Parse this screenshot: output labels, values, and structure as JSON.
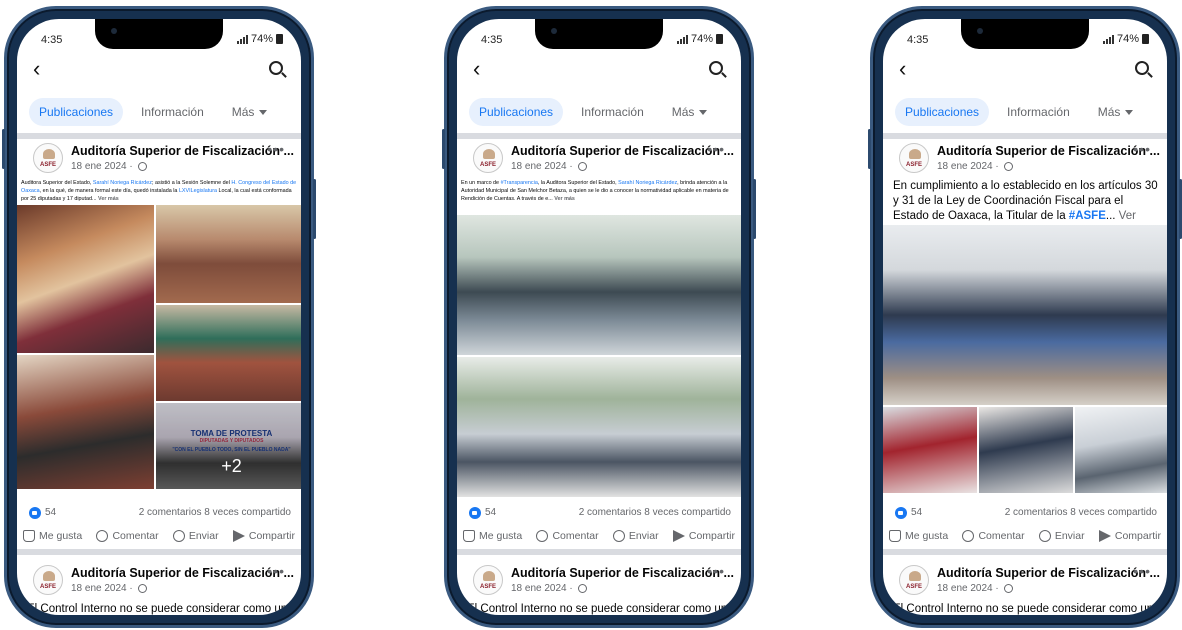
{
  "phones": [
    {
      "status": {
        "time": "4:35",
        "battery": "74%"
      },
      "tabs": {
        "posts": "Publicaciones",
        "info": "Información",
        "more": "Más"
      },
      "post": {
        "page_name": "Auditoría Superior de Fiscalización ...",
        "date": "18 ene 2024 ·",
        "avatar_text": "ASFE",
        "caption_parts": [
          {
            "t": "Auditora Superior del Estado, ",
            "k": "text"
          },
          {
            "t": "Sarahí Noriega Ricárdez",
            "k": "link"
          },
          {
            "t": "; asistió a la Sesión Solemne del ",
            "k": "text"
          },
          {
            "t": "H. Congreso del Estado de Oaxaca",
            "k": "link"
          },
          {
            "t": ", en la qué, de manera formal este día, quedó instalada la ",
            "k": "text"
          },
          {
            "t": "LXVILegislatura",
            "k": "link"
          },
          {
            "t": " Local, la cual está conformada por 25 diputadas y 17 diputad... ",
            "k": "text"
          },
          {
            "t": "Ver más",
            "k": "more"
          }
        ],
        "image_banner": {
          "title": "TOMA DE PROTESTA",
          "subtitle": "DIPUTADAS Y DIPUTADOS",
          "motto": "\"CON EL PUEBLO TODO, SIN EL PUEBLO NADA\""
        },
        "more_photos": "+2",
        "likes": "54",
        "comments_shares": "2 comentarios  8 veces compartido",
        "actions": {
          "like": "Me gusta",
          "comment": "Comentar",
          "send": "Enviar",
          "share": "Compartir"
        }
      },
      "next_post": {
        "page_name": "Auditoría Superior de Fiscalización ...",
        "date": "18 ene 2024 ·",
        "teaser": "El Control Interno no se puede considerar como un"
      }
    },
    {
      "status": {
        "time": "4:35",
        "battery": "74%"
      },
      "tabs": {
        "posts": "Publicaciones",
        "info": "Información",
        "more": "Más"
      },
      "post": {
        "page_name": "Auditoría Superior de Fiscalización ...",
        "date": "18 ene 2024 ·",
        "avatar_text": "ASFE",
        "caption_parts": [
          {
            "t": "En un marco de ",
            "k": "text"
          },
          {
            "t": "#Transparencia",
            "k": "link"
          },
          {
            "t": ", la Auditora Superior del Estado, ",
            "k": "text"
          },
          {
            "t": "Sarahí Noriega Ricárdez",
            "k": "link"
          },
          {
            "t": ", brinda atención a la Autoridad Municipal de San Melchor Betaza, a quien se le dio a conocer la normatividad aplicable en materia de Rendición de Cuentas.",
            "k": "text"
          },
          {
            "t": " A través de e... ",
            "k": "text"
          },
          {
            "t": "Ver más",
            "k": "more"
          }
        ],
        "likes": "54",
        "comments_shares": "2 comentarios  8 veces compartido",
        "actions": {
          "like": "Me gusta",
          "comment": "Comentar",
          "send": "Enviar",
          "share": "Compartir"
        }
      },
      "next_post": {
        "page_name": "Auditoría Superior de Fiscalización ...",
        "date": "18 ene 2024 ·",
        "teaser": "El Control Interno no se puede considerar como un"
      }
    },
    {
      "status": {
        "time": "4:35",
        "battery": "74%"
      },
      "tabs": {
        "posts": "Publicaciones",
        "info": "Información",
        "more": "Más"
      },
      "post": {
        "page_name": "Auditoría Superior de Fiscalización ...",
        "date": "18 ene 2024 ·",
        "avatar_text": "ASFE",
        "caption_parts": [
          {
            "t": "En cumplimiento a lo establecido en los artículos 30 y 31 de la Ley de Coordinación Fiscal para el Estado de Oaxaca, la Titular de la ",
            "k": "text"
          },
          {
            "t": "#ASFE",
            "k": "hashtag"
          },
          {
            "t": "... ",
            "k": "text"
          },
          {
            "t": "Ver más",
            "k": "more"
          }
        ],
        "likes": "54",
        "comments_shares": "2 comentarios  8 veces compartido",
        "actions": {
          "like": "Me gusta",
          "comment": "Comentar",
          "send": "Enviar",
          "share": "Compartir"
        }
      },
      "next_post": {
        "page_name": "Auditoría Superior de Fiscalización ...",
        "date": "18 ene 2024 ·",
        "teaser": "El Control Interno no se puede considerar como un"
      }
    }
  ]
}
